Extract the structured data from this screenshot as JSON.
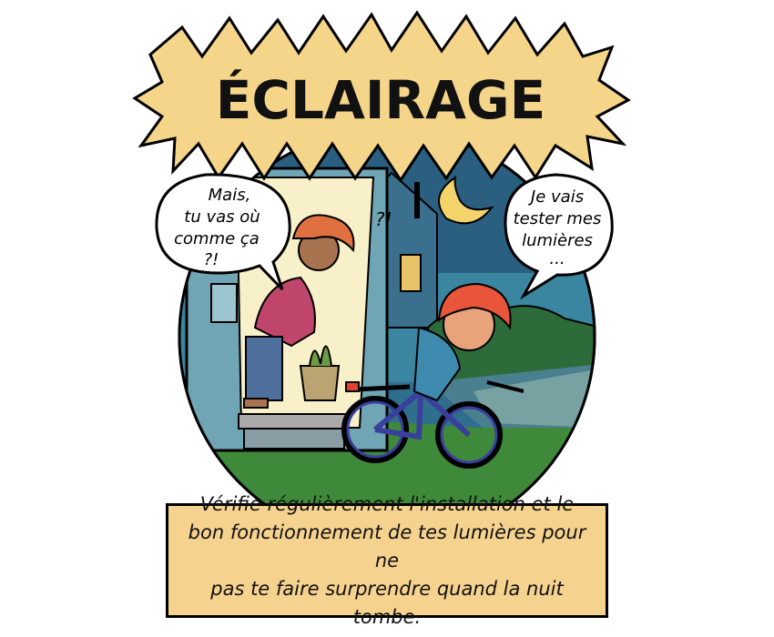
{
  "title": {
    "text": "ÉCLAIRAGE"
  },
  "bubble_mother": {
    "lines": [
      "Mais,",
      "tu vas où",
      "comme ça",
      "?!"
    ]
  },
  "bubble_child": {
    "lines": [
      "Je vais",
      "tester mes",
      "lumières",
      "..."
    ]
  },
  "door_exclaim": "?!",
  "caption": {
    "lines": [
      "Vérifie régulièrement l'installation et le",
      "bon fonctionnement de tes lumières pour ne",
      "pas te faire surprendre quand la nuit tombe."
    ]
  },
  "colors": {
    "title_burst": "#f5d58a",
    "night_sky": "#2f6e8c",
    "door_light": "#f7f0c8",
    "grass": "#3f8a3a",
    "helmet": "#e8553a",
    "bike": "#3a3f9c",
    "caption_bg": "#f6d28f"
  }
}
